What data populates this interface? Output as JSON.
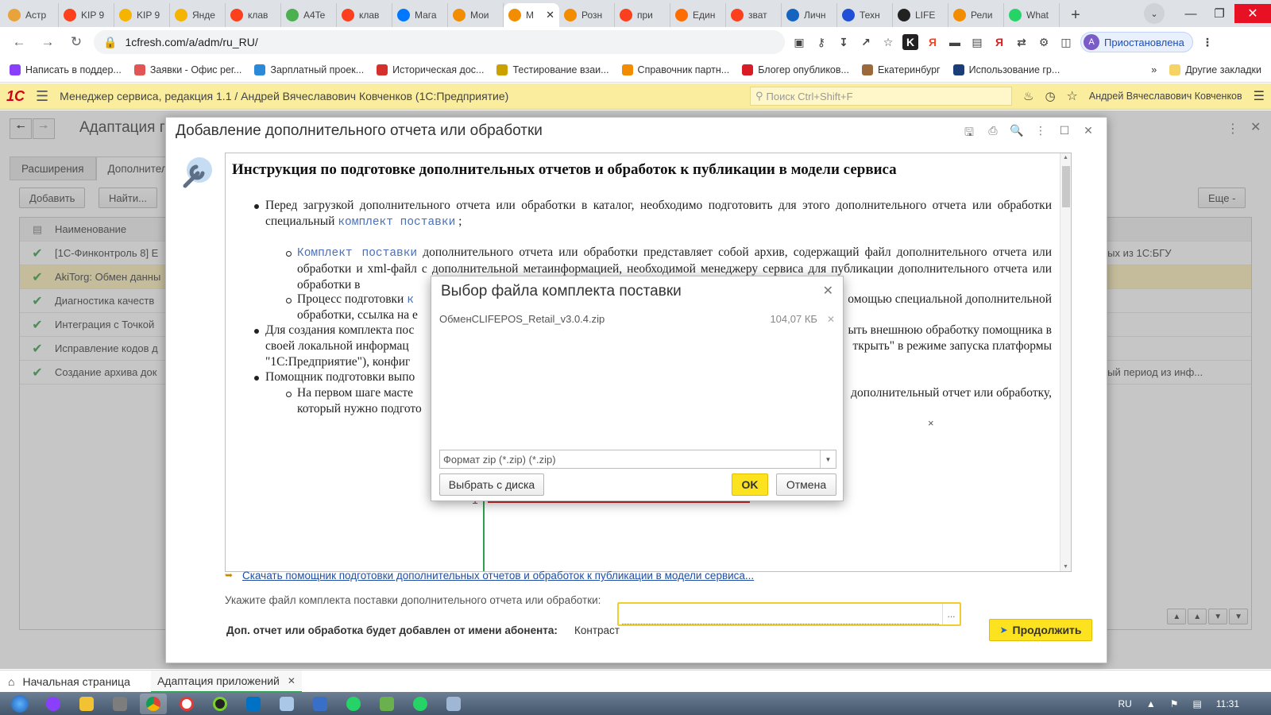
{
  "browser": {
    "tabs": [
      {
        "label": "Астр",
        "icon_color": "#e8a33a"
      },
      {
        "label": "KIP 9",
        "icon_color": "#fc3f1d"
      },
      {
        "label": "KIP 9",
        "icon_color": "#f4b400"
      },
      {
        "label": "Янде",
        "icon_color": "#f4b400"
      },
      {
        "label": "клав",
        "icon_color": "#fc3f1d"
      },
      {
        "label": "A4Te",
        "icon_color": "#4caf50"
      },
      {
        "label": "клав",
        "icon_color": "#fc3f1d"
      },
      {
        "label": "Мага",
        "icon_color": "#0077ff"
      },
      {
        "label": "Мои",
        "icon_color": "#f28c00"
      },
      {
        "label": "М",
        "icon_color": "#f28c00",
        "active": true
      },
      {
        "label": "Розн",
        "icon_color": "#f28c00"
      },
      {
        "label": "при",
        "icon_color": "#fc3f1d"
      },
      {
        "label": "Един",
        "icon_color": "#ff6d00"
      },
      {
        "label": "зват",
        "icon_color": "#fc3f1d"
      },
      {
        "label": "Личн",
        "icon_color": "#1565c0"
      },
      {
        "label": "Техн",
        "icon_color": "#1e4fd6"
      },
      {
        "label": "LIFE",
        "icon_color": "#222222"
      },
      {
        "label": "Рели",
        "icon_color": "#f28c00"
      },
      {
        "label": "What",
        "icon_color": "#25d366"
      }
    ],
    "new_tab": "+",
    "url": "1cfresh.com/a/adm/ru_RU/",
    "profile_initial": "А",
    "profile_label": "Приостановлена",
    "bookmarks": [
      {
        "label": "Написать в поддер...",
        "color": "#8a3ffc"
      },
      {
        "label": "Заявки - Офис рег...",
        "color": "#e25555"
      },
      {
        "label": "Зарплатный проек...",
        "color": "#2b8ad8"
      },
      {
        "label": "Историческая дос...",
        "color": "#d4302c"
      },
      {
        "label": "Тестирование взаи...",
        "color": "#c9a100"
      },
      {
        "label": "Справочник партн...",
        "color": "#f28c00"
      },
      {
        "label": "Блогер опубликов...",
        "color": "#d81b24"
      },
      {
        "label": "Екатеринбург",
        "color": "#9c6a3a"
      },
      {
        "label": "Использование гр...",
        "color": "#1b3e7a"
      }
    ],
    "bookmarks_more": "»",
    "other_bookmarks": "Другие закладки"
  },
  "app": {
    "logo": "1С",
    "title": "Менеджер сервиса, редакция 1.1 / Андрей Вячеславович Ковченков  (1С:Предприятие)",
    "search_placeholder": "Поиск Ctrl+Shift+F",
    "user": "Андрей Вячеславович Ковченков"
  },
  "bgform": {
    "title": "Адаптация г",
    "tabs": [
      "Расширения",
      "Дополнитель"
    ],
    "buttons": {
      "add": "Добавить",
      "find": "Найти...",
      "more": "Еще -"
    },
    "column": "Наименование",
    "rows": [
      {
        "name": "[1С-Финконтроль 8] Е",
        "right": "данных из 1С:БГУ"
      },
      {
        "name": "AkiTorg: Обмен данны",
        "right": "",
        "selected": true
      },
      {
        "name": "Диагностика качеств",
        "right": ""
      },
      {
        "name": "Интеграция с Точкой",
        "right": ""
      },
      {
        "name": "Исправление кодов д",
        "right": ""
      },
      {
        "name": "Создание архива док",
        "right": "ленный период из инф..."
      }
    ]
  },
  "dialog": {
    "title": "Добавление дополнительного отчета или обработки",
    "doc": {
      "heading": "Инструкция по подготовке дополнительных отчетов и обработок к публикации в модели сервиса",
      "p1a": "Перед загрузкой дополнительного отчета или обработки в каталог, необходимо подготовить для этого дополнительного отчета или обработки специальный",
      "p1link": "комплект поставки",
      "p1end": ";",
      "s1link": "Комплект поставки",
      "s1a": "дополнительного отчета или обработки представляет собой архив, содержащий файл дополнительного отчета или обработки и xml-файл с дополнительной метаинформацией, необходимой менеджеру сервиса для публикации дополнительного отчета или обработки в",
      "s2a": "Процесс подготовки",
      "s2link": "к",
      "s2b": "омощью специальной дополнительной",
      "s2c": "обработки, ссылка на е",
      "p2a": "Для создания комплекта пос",
      "p2b": "ыть внешнюю обработку помощника в",
      "p2c": "своей локальной информац",
      "p2d": "ткрыть\" в режиме запуска платформы",
      "p2e": "\"1С:Предприятие\"), конфиг",
      "p2f": ";",
      "p3a": "Помощник подготовки выпо",
      "s3a": "На первом шаге масте",
      "s3b": "дополнительный отчет или обработку,",
      "s3c": "который нужно подгото",
      "fig_close": "×",
      "fig_marker": "1"
    },
    "download_link": "Скачать помощник подготовки дополнительных отчетов и обработок к публикации в модели сервиса...",
    "file_label": "Укажите файл комплекта поставки дополнительного отчета или обработки:",
    "file_value": "",
    "file_btn": "...",
    "subscriber_label": "Доп. отчет или обработка будет добавлен от имени абонента:",
    "subscriber_value": "Контраст",
    "continue_btn": "Продолжить"
  },
  "file_dialog": {
    "title": "Выбор файла комплекта поставки",
    "file_name": "ОбменCLIFEPOS_Retail_v3.0.4.zip",
    "file_size": "104,07 КБ",
    "format": "Формат zip (*.zip) (*.zip)",
    "choose_disk": "Выбрать с диска",
    "ok": "OK",
    "cancel": "Отмена"
  },
  "oc_tabs": {
    "home": "Начальная страница",
    "active": "Адаптация приложений"
  },
  "taskbar": {
    "lang": "RU",
    "time": "11:31"
  },
  "colors": {
    "accent_yellow": "#fce21f",
    "header_bg": "#fbed9e",
    "link": "#1f4ea3",
    "check_green": "#2a9d3f"
  }
}
